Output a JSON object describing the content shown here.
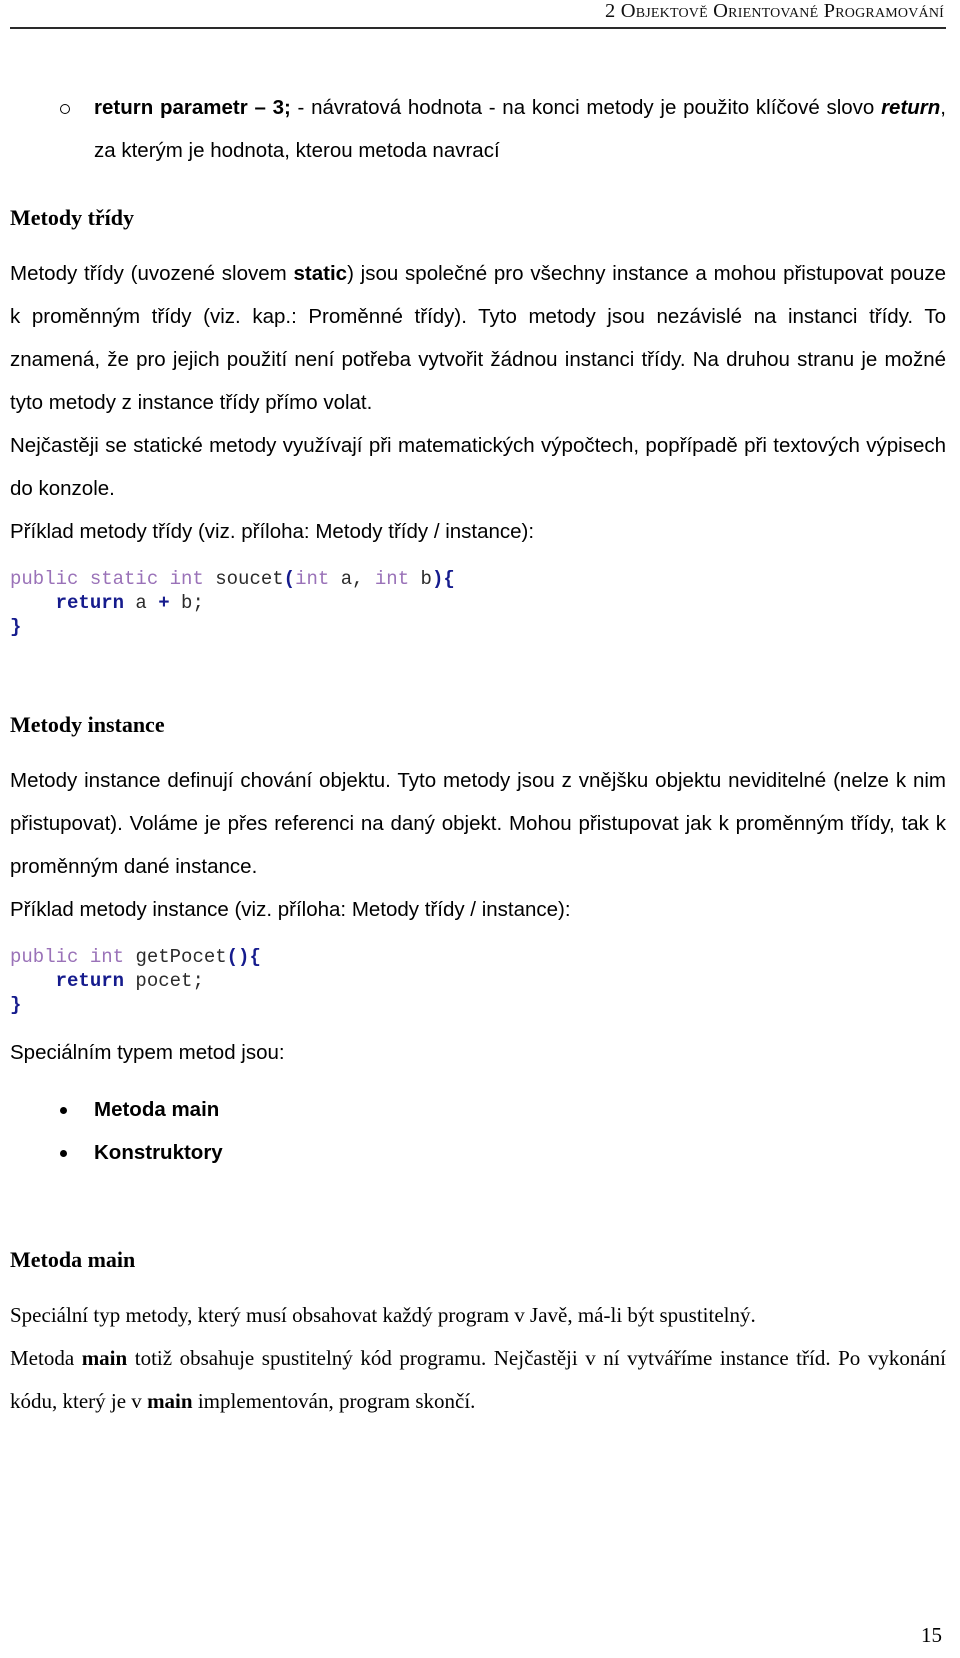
{
  "header": {
    "title": "2 Objektově Orientované Programování"
  },
  "bullets_top": [
    {
      "lead": "return parametr – 3;",
      "text_a": " - návratová hodnota - na konci metody je použito klíčové slovo ",
      "emph": "return",
      "text_b": ", za kterým je hodnota, kterou metoda navrací"
    }
  ],
  "sections": {
    "metody_tridy": {
      "heading": "Metody třídy",
      "p1_a": "Metody třídy (uvozené slovem ",
      "p1_kw": "static",
      "p1_b": ") jsou společné pro všechny instance a mohou přistupovat pouze k proměnným třídy (viz. kap.: Proměnné třídy). Tyto metody jsou nezávislé na instanci třídy. To znamená, že pro jejich použití není potřeba vytvořit žádnou instanci třídy. Na druhou stranu je možné tyto metody z instance třídy přímo volat.",
      "p2": "Nejčastěji se statické metody využívají při matematických výpočtech, popřípadě při textových výpisech do konzole.",
      "p3": "Příklad metody třídy (viz. příloha: Metody třídy / instance):",
      "code": {
        "line1": {
          "kw1": "public static int",
          "space1": " ",
          "name": "soucet",
          "punc_open": "(",
          "kw2": "int",
          "arg1": " a, ",
          "kw3": "int",
          "arg2": " b",
          "punc_close": "){"
        },
        "line2": {
          "indent": "    ",
          "ret": "return",
          "body": " a ",
          "op": "+",
          "tail": " b;"
        },
        "line3": "}"
      }
    },
    "metody_instance": {
      "heading": "Metody instance",
      "p1": "Metody instance definují chování objektu. Tyto metody jsou z vnějšku objektu neviditelné (nelze k nim přistupovat). Voláme je přes referenci na daný objekt. Mohou přistupovat jak k proměnným třídy, tak k proměnným dané instance.",
      "p2": "Příklad metody instance (viz. příloha: Metody třídy / instance):",
      "code": {
        "line1": {
          "kw1": "public int",
          "space1": " ",
          "name": "getPocet",
          "punc": "(){"
        },
        "line2": {
          "indent": "    ",
          "ret": "return",
          "tail": " pocet;"
        },
        "line3": "}"
      },
      "p3": "Speciálním typem metod jsou:"
    },
    "special_types": [
      {
        "label": "Metoda main"
      },
      {
        "label": "Konstruktory"
      }
    ],
    "metoda_main": {
      "heading": "Metoda main",
      "p1": "Speciální typ metody, který musí obsahovat každý program v Javě, má-li být spustitelný.",
      "p2_a": "Metoda ",
      "p2_kw": "main",
      "p2_b": " totiž obsahuje spustitelný kód programu. Nejčastěji v ní vytváříme instance tříd. Po vykonání kódu, který je v ",
      "p2_kw2": "main",
      "p2_c": " implementován, program skončí."
    }
  },
  "footer": {
    "page_number": "15"
  },
  "colors": {
    "keyword": "#9a72b8",
    "punctuation": "#151b8d",
    "text": "#000000",
    "rule": "#2a2a2a"
  }
}
